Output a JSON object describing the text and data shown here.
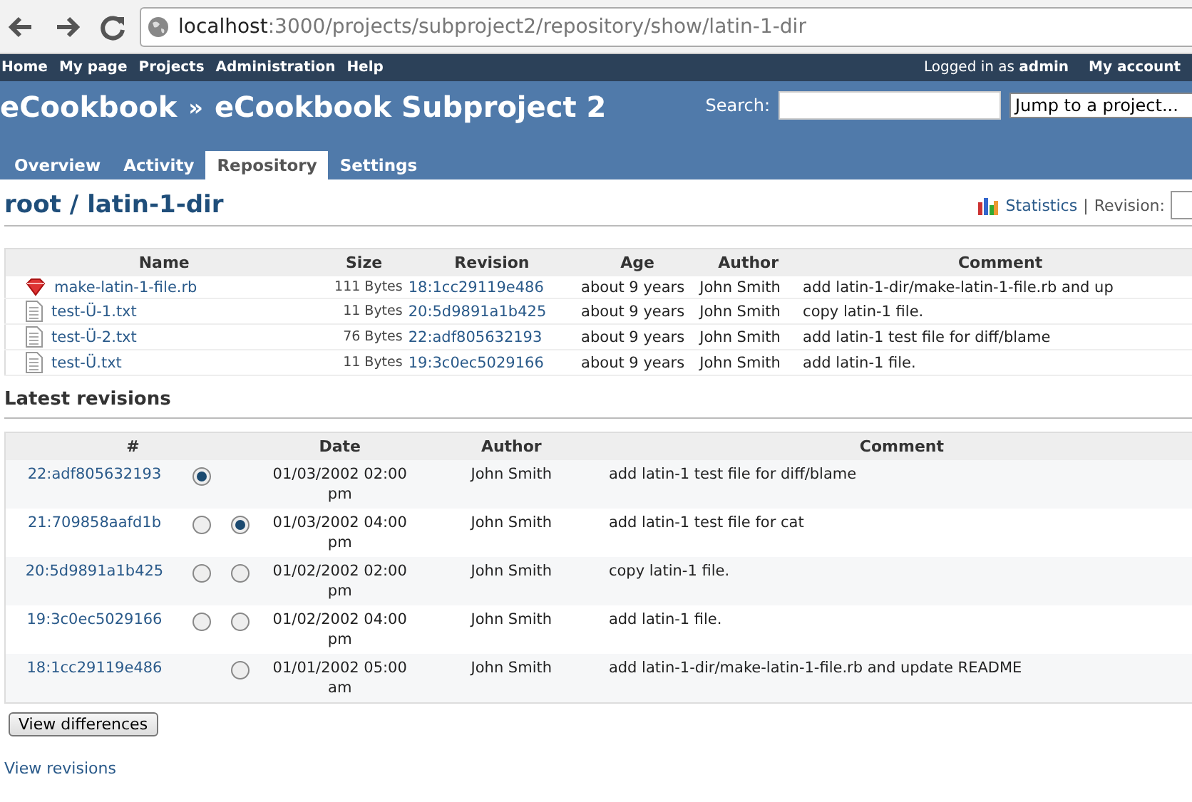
{
  "browser": {
    "host": "localhost",
    "path": ":3000/projects/subproject2/repository/show/latin-1-dir"
  },
  "top_menu": {
    "items": [
      "Home",
      "My page",
      "Projects",
      "Administration",
      "Help"
    ],
    "logged_in_prefix": "Logged in as",
    "user": "admin",
    "account": "My account"
  },
  "header": {
    "parent": "eCookbook",
    "separator": "»",
    "project": "eCookbook Subproject 2",
    "search_label": "Search:",
    "jump_placeholder": "Jump to a project..."
  },
  "tabs": [
    {
      "label": "Overview",
      "selected": false
    },
    {
      "label": "Activity",
      "selected": false
    },
    {
      "label": "Repository",
      "selected": true
    },
    {
      "label": "Settings",
      "selected": false
    }
  ],
  "breadcrumb": {
    "root": "root",
    "separator": "/",
    "dir": "latin-1-dir"
  },
  "contextual": {
    "statistics": "Statistics",
    "separator": "|",
    "revision_label": "Revision:"
  },
  "files": {
    "columns": [
      "Name",
      "Size",
      "Revision",
      "Age",
      "Author",
      "Comment"
    ],
    "rows": [
      {
        "kind": "ruby",
        "name": "make-latin-1-file.rb",
        "size": "111 Bytes",
        "revision": "18:1cc29119e486",
        "age": "about 9 years",
        "author": "John Smith",
        "comment": "add latin-1-dir/make-latin-1-file.rb and up"
      },
      {
        "kind": "text",
        "name": "test-Ü-1.txt",
        "size": "11 Bytes",
        "revision": "20:5d9891a1b425",
        "age": "about 9 years",
        "author": "John Smith",
        "comment": "copy latin-1 file."
      },
      {
        "kind": "text",
        "name": "test-Ü-2.txt",
        "size": "76 Bytes",
        "revision": "22:adf805632193",
        "age": "about 9 years",
        "author": "John Smith",
        "comment": "add latin-1 test file for diff/blame"
      },
      {
        "kind": "text",
        "name": "test-Ü.txt",
        "size": "11 Bytes",
        "revision": "19:3c0ec5029166",
        "age": "about 9 years",
        "author": "John Smith",
        "comment": "add latin-1 file."
      }
    ]
  },
  "revisions": {
    "title": "Latest revisions",
    "columns": [
      "#",
      "Date",
      "Author",
      "Comment"
    ],
    "rows": [
      {
        "id": "22:adf805632193",
        "from": {
          "selected": true
        },
        "date": "01/03/2002 02:00 pm",
        "author": "John Smith",
        "comment": "add latin-1 test file for diff/blame"
      },
      {
        "id": "21:709858aafd1b",
        "from": {
          "selected": false
        },
        "to": {
          "selected": true
        },
        "date": "01/03/2002 04:00 pm",
        "author": "John Smith",
        "comment": "add latin-1 test file for cat"
      },
      {
        "id": "20:5d9891a1b425",
        "from": {
          "selected": false
        },
        "to": {
          "selected": false
        },
        "date": "01/02/2002 02:00 pm",
        "author": "John Smith",
        "comment": "copy latin-1 file."
      },
      {
        "id": "19:3c0ec5029166",
        "from": {
          "selected": false
        },
        "to": {
          "selected": false
        },
        "date": "01/02/2002 04:00 pm",
        "author": "John Smith",
        "comment": "add latin-1 file."
      },
      {
        "id": "18:1cc29119e486",
        "to": {
          "selected": false
        },
        "date": "01/01/2002 05:00 am",
        "author": "John Smith",
        "comment": "add latin-1-dir/make-latin-1-file.rb and update README"
      }
    ],
    "button": "View differences",
    "link": "View revisions"
  }
}
